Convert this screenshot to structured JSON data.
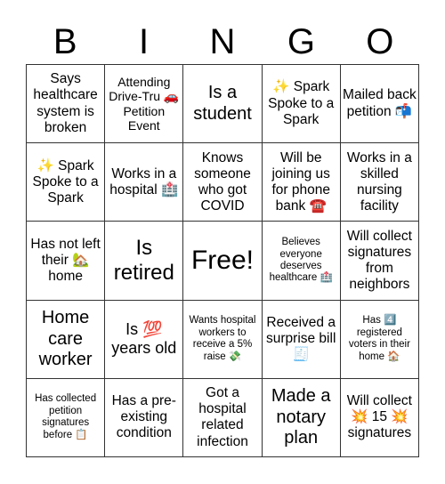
{
  "header": {
    "letters": [
      "B",
      "I",
      "N",
      "G",
      "O"
    ]
  },
  "board": {
    "cells": [
      "Says healthcare system is broken",
      "Attending Drive-Tru 🚗 Petition Event",
      "Is a student",
      "✨ Spark Spoke to a Spark",
      "Mailed back petition 📬",
      "✨ Spark Spoke to a Spark",
      "Works in a hospital 🏥",
      "Knows someone who got COVID",
      "Will be joining us for phone bank ☎️",
      "Works in a skilled nursing facility",
      "Has not left their 🏡 home",
      "Is retired",
      "Free!",
      "Believes everyone deserves healthcare 🏥",
      "Will collect signatures from neighbors",
      "Home care worker",
      "Is 💯 years old",
      "Wants hospital workers to receive a 5% raise 💸",
      "Received a surprise bill 🧾",
      "Has 4️⃣ registered voters in their home 🏠",
      "Has collected petition signatures before 📋",
      "Has a pre-existing condition",
      "Got a hospital related infection",
      "Made a notary plan",
      "Will collect 💥 15 💥 signatures"
    ]
  }
}
